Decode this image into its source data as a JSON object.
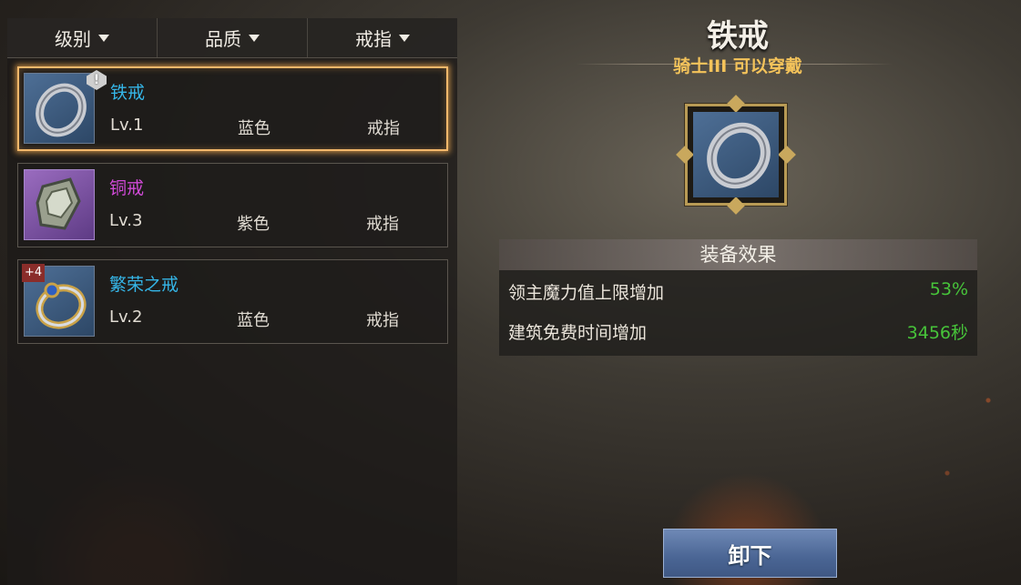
{
  "filters": [
    {
      "label": "级别"
    },
    {
      "label": "品质"
    },
    {
      "label": "戒指"
    }
  ],
  "items": [
    {
      "name": "铁戒",
      "level": "Lv.1",
      "quality": "蓝色",
      "type": "戒指",
      "name_color": "#35b6e8",
      "icon": "iron-ring-icon",
      "selected": true,
      "badge": "!"
    },
    {
      "name": "铜戒",
      "level": "Lv.3",
      "quality": "紫色",
      "type": "戒指",
      "name_color": "#d14ad8",
      "icon": "copper-ring-icon"
    },
    {
      "name": "繁荣之戒",
      "level": "Lv.2",
      "quality": "蓝色",
      "type": "戒指",
      "name_color": "#35b6e8",
      "icon": "prosperity-ring-icon",
      "plus": "+4"
    }
  ],
  "detail": {
    "title": "铁戒",
    "requirement": "骑士III 可以穿戴",
    "icon": "iron-ring-icon",
    "effects_title": "装备效果",
    "effects": [
      {
        "label": "领主魔力值上限增加",
        "value": "53%"
      },
      {
        "label": "建筑免费时间增加",
        "value": "3456秒"
      }
    ],
    "unequip_label": "卸下"
  },
  "colors": {
    "selected_border": "#f3b86b",
    "requirement": "#f4c35a",
    "effect_value": "#47c43a",
    "button": "#4a6594"
  }
}
